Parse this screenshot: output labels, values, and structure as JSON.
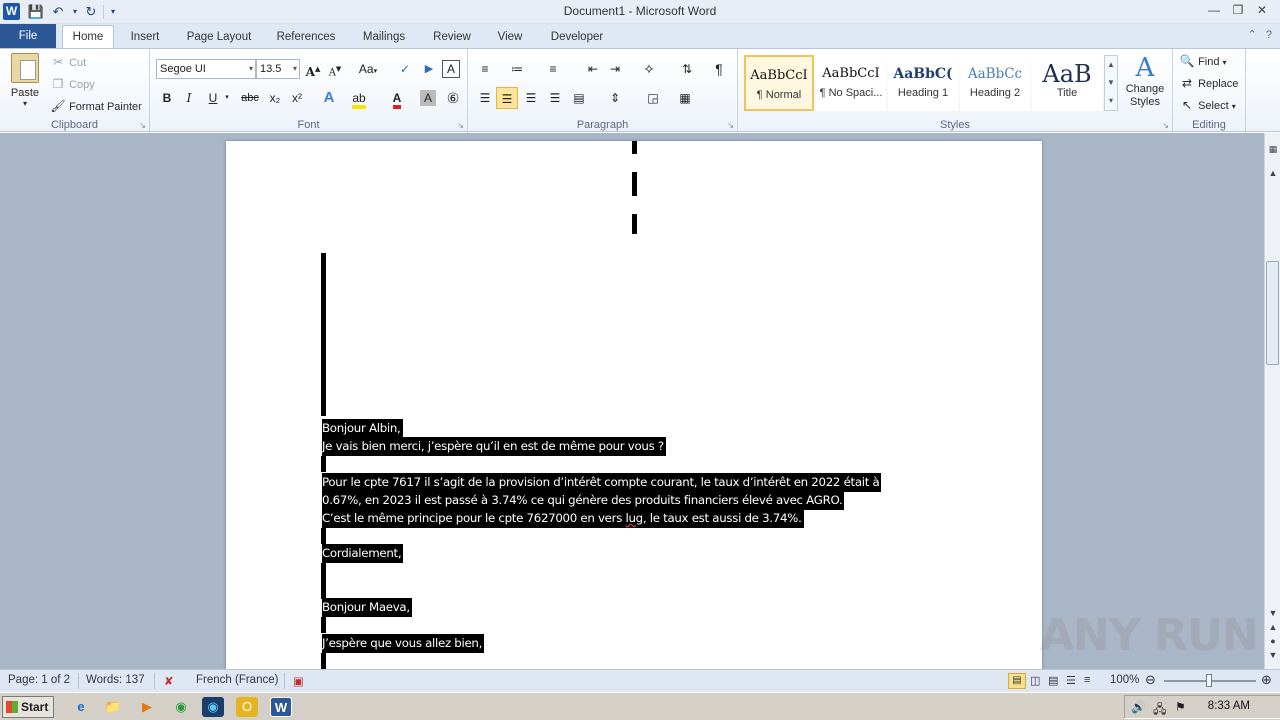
{
  "window": {
    "title": "Document1 - Microsoft Word",
    "qat_icons": [
      "save-icon",
      "undo-icon",
      "redo-icon",
      "customize-qat-icon"
    ]
  },
  "tabs": [
    {
      "label": "File"
    },
    {
      "label": "Home"
    },
    {
      "label": "Insert"
    },
    {
      "label": "Page Layout"
    },
    {
      "label": "References"
    },
    {
      "label": "Mailings"
    },
    {
      "label": "Review"
    },
    {
      "label": "View"
    },
    {
      "label": "Developer"
    }
  ],
  "ribbon": {
    "clipboard": {
      "group_label": "Clipboard",
      "paste": "Paste",
      "cut": "Cut",
      "copy": "Copy",
      "format_painter": "Format Painter"
    },
    "font": {
      "group_label": "Font",
      "font_name": "Segoe UI",
      "font_size": "13.5",
      "bold": "B",
      "italic": "I",
      "underline": "U",
      "strike": "abc",
      "subscript": "x₂",
      "superscript": "x²",
      "grow": "A",
      "shrink": "A",
      "change_case": "Aa"
    },
    "paragraph": {
      "group_label": "Paragraph",
      "pilcrow": "¶"
    },
    "styles": {
      "group_label": "Styles",
      "items": [
        {
          "sample": "AaBbCcI",
          "name": "¶ Normal"
        },
        {
          "sample": "AaBbCcI",
          "name": "¶ No Spaci..."
        },
        {
          "sample": "AaBbC(",
          "name": "Heading 1"
        },
        {
          "sample": "AaBbCc",
          "name": "Heading 2"
        },
        {
          "sample": "AaB",
          "name": "Title"
        }
      ],
      "change_styles": "Change Styles"
    },
    "editing": {
      "group_label": "Editing",
      "find": "Find",
      "replace": "Replace",
      "select": "Select"
    }
  },
  "document": {
    "lines": [
      {
        "text": "Bonjour Albin,"
      },
      {
        "text": "Je vais bien merci, j’espère qu’il en est de même pour vous ?"
      },
      {
        "text": "Pour le cpte 7617 il s’agit de la provision d’intérêt compte courant, le taux d’intérêt en 2022 était à"
      },
      {
        "text": "0.67%, en 2023 il est passé à 3.74% ce qui génère des produits financiers élevé avec AGRO."
      },
      {
        "text_before": "C’est le même principe pour le cpte 7627000 en vers ",
        "text_flag": "lug",
        "text_after": ", le taux est aussi de 3.74%."
      },
      {
        "text": "Cordialement,"
      },
      {
        "text": "Bonjour Maeva,"
      },
      {
        "text": "J’espère que vous allez bien,"
      }
    ]
  },
  "statusbar": {
    "page": "Page: 1 of 2",
    "words": "Words: 137",
    "language": "French (France)",
    "zoom": "100%",
    "zoom_level_percent": 100
  },
  "taskbar": {
    "start_label": "Start",
    "clock": "8:33 AM"
  },
  "watermark": "ANY RUN"
}
